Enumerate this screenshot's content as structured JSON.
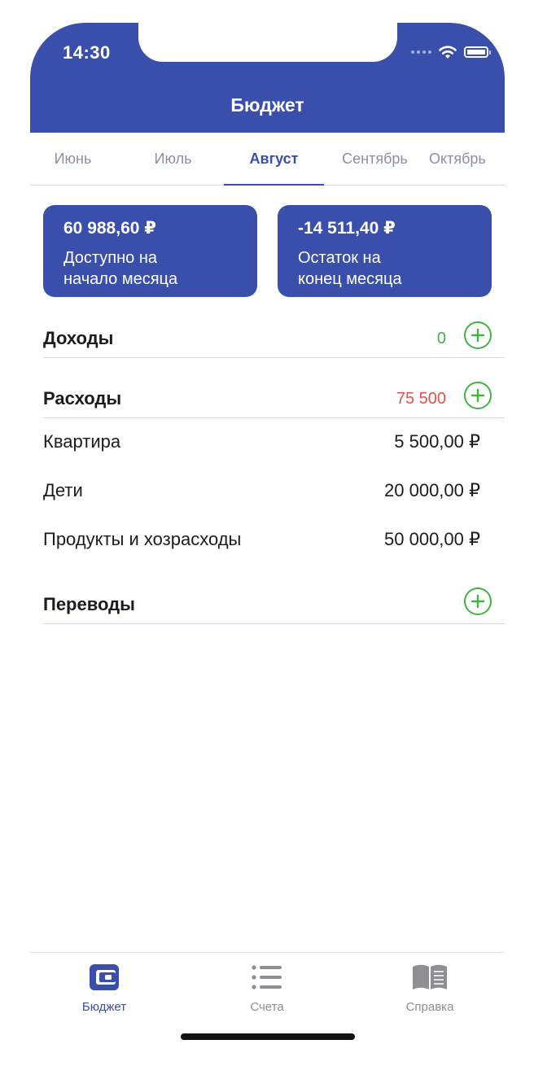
{
  "status_bar": {
    "time": "14:30"
  },
  "header": {
    "title": "Бюджет"
  },
  "months": {
    "tabs": [
      {
        "label": "Июнь"
      },
      {
        "label": "Июль"
      },
      {
        "label": "Август"
      },
      {
        "label": "Сентябрь"
      },
      {
        "label": "Октябрь"
      }
    ],
    "active": "Август"
  },
  "summary": {
    "start": {
      "amount": "60 988,60 ₽",
      "label": "Доступно на\nначало месяца"
    },
    "end": {
      "amount": "-14 511,40 ₽",
      "label": "Остаток на\nконец месяца"
    }
  },
  "income": {
    "title": "Доходы",
    "total": "0"
  },
  "expenses": {
    "title": "Расходы",
    "total": "75 500",
    "items": [
      {
        "name": "Квартира",
        "amount": "5 500,00 ₽"
      },
      {
        "name": "Дети",
        "amount": "20 000,00 ₽"
      },
      {
        "name": "Продукты и хозрасходы",
        "amount": "50 000,00 ₽"
      }
    ]
  },
  "transfers": {
    "title": "Переводы"
  },
  "tabbar": {
    "items": [
      {
        "label": "Бюджет",
        "icon": "wallet-icon",
        "active": true
      },
      {
        "label": "Счета",
        "icon": "list-icon",
        "active": false
      },
      {
        "label": "Справка",
        "icon": "book-icon",
        "active": false
      }
    ]
  },
  "colors": {
    "primary": "#3a4fac",
    "income_green": "#3fb53f",
    "expense_red": "#e0524d",
    "inactive_gray": "#8e8e93"
  }
}
